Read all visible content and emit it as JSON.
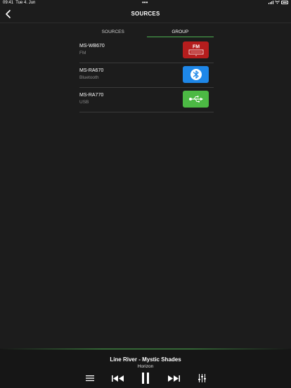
{
  "status": {
    "time": "09:41",
    "date": "Tue 4. Jun",
    "dots": "•••"
  },
  "nav": {
    "title": "SOURCES",
    "back_icon": "chevron-left-icon"
  },
  "tabs": [
    {
      "label": "SOURCES",
      "active": false
    },
    {
      "label": "GROUP",
      "active": true
    }
  ],
  "sources": [
    {
      "name": "MS-WB670",
      "type": "FM",
      "icon": "fm-radio-icon",
      "color": "#b51d1d",
      "badge": "FM"
    },
    {
      "name": "MS-RA670",
      "type": "Bluetooth",
      "icon": "bluetooth-icon",
      "color": "#1e87e8"
    },
    {
      "name": "MS-RA770",
      "type": "USB",
      "icon": "usb-icon",
      "color": "#4cb944"
    }
  ],
  "player": {
    "track": "Line River - Mystic Shades",
    "album": "Horizon",
    "accent": "#4caf50"
  }
}
